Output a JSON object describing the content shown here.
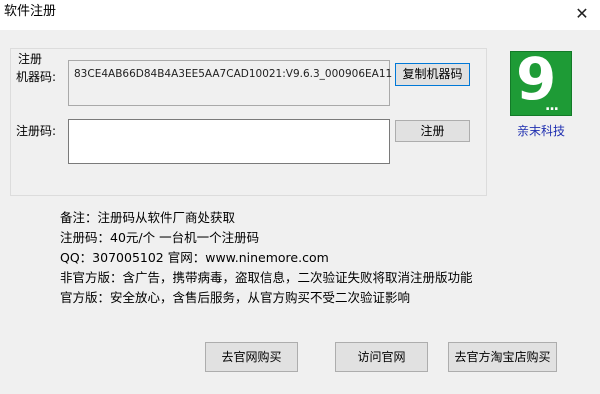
{
  "window": {
    "title": "软件注册",
    "close_glyph": "✕"
  },
  "register": {
    "group_label": "注册",
    "machine_code_label": "机器码:",
    "machine_code_value": "83CE4AB66D84B4A3EE5AA7CAD10021:V9.6.3_000906EA11",
    "copy_button": "复制机器码",
    "reg_code_label": "注册码:",
    "reg_code_value": "",
    "register_button": "注册"
  },
  "brand": {
    "logo_text": "9",
    "logo_dots": "...",
    "name": "亲末科技",
    "logo_color": "#1e9b36",
    "name_color": "#1f2fb0"
  },
  "notes": [
    "备注：注册码从软件厂商处获取",
    "注册码：40元/个 一台机一个注册码",
    "QQ：307005102 官网：www.ninemore.com",
    "非官方版：含广告，携带病毒，盗取信息，二次验证失败将取消注册版功能",
    "官方版：安全放心，含售后服务，从官方购买不受二次验证影响"
  ],
  "bottom_buttons": {
    "official_site_buy": "去官网购买",
    "visit_site": "访问官网",
    "taobao_buy": "去官方淘宝店购买"
  }
}
